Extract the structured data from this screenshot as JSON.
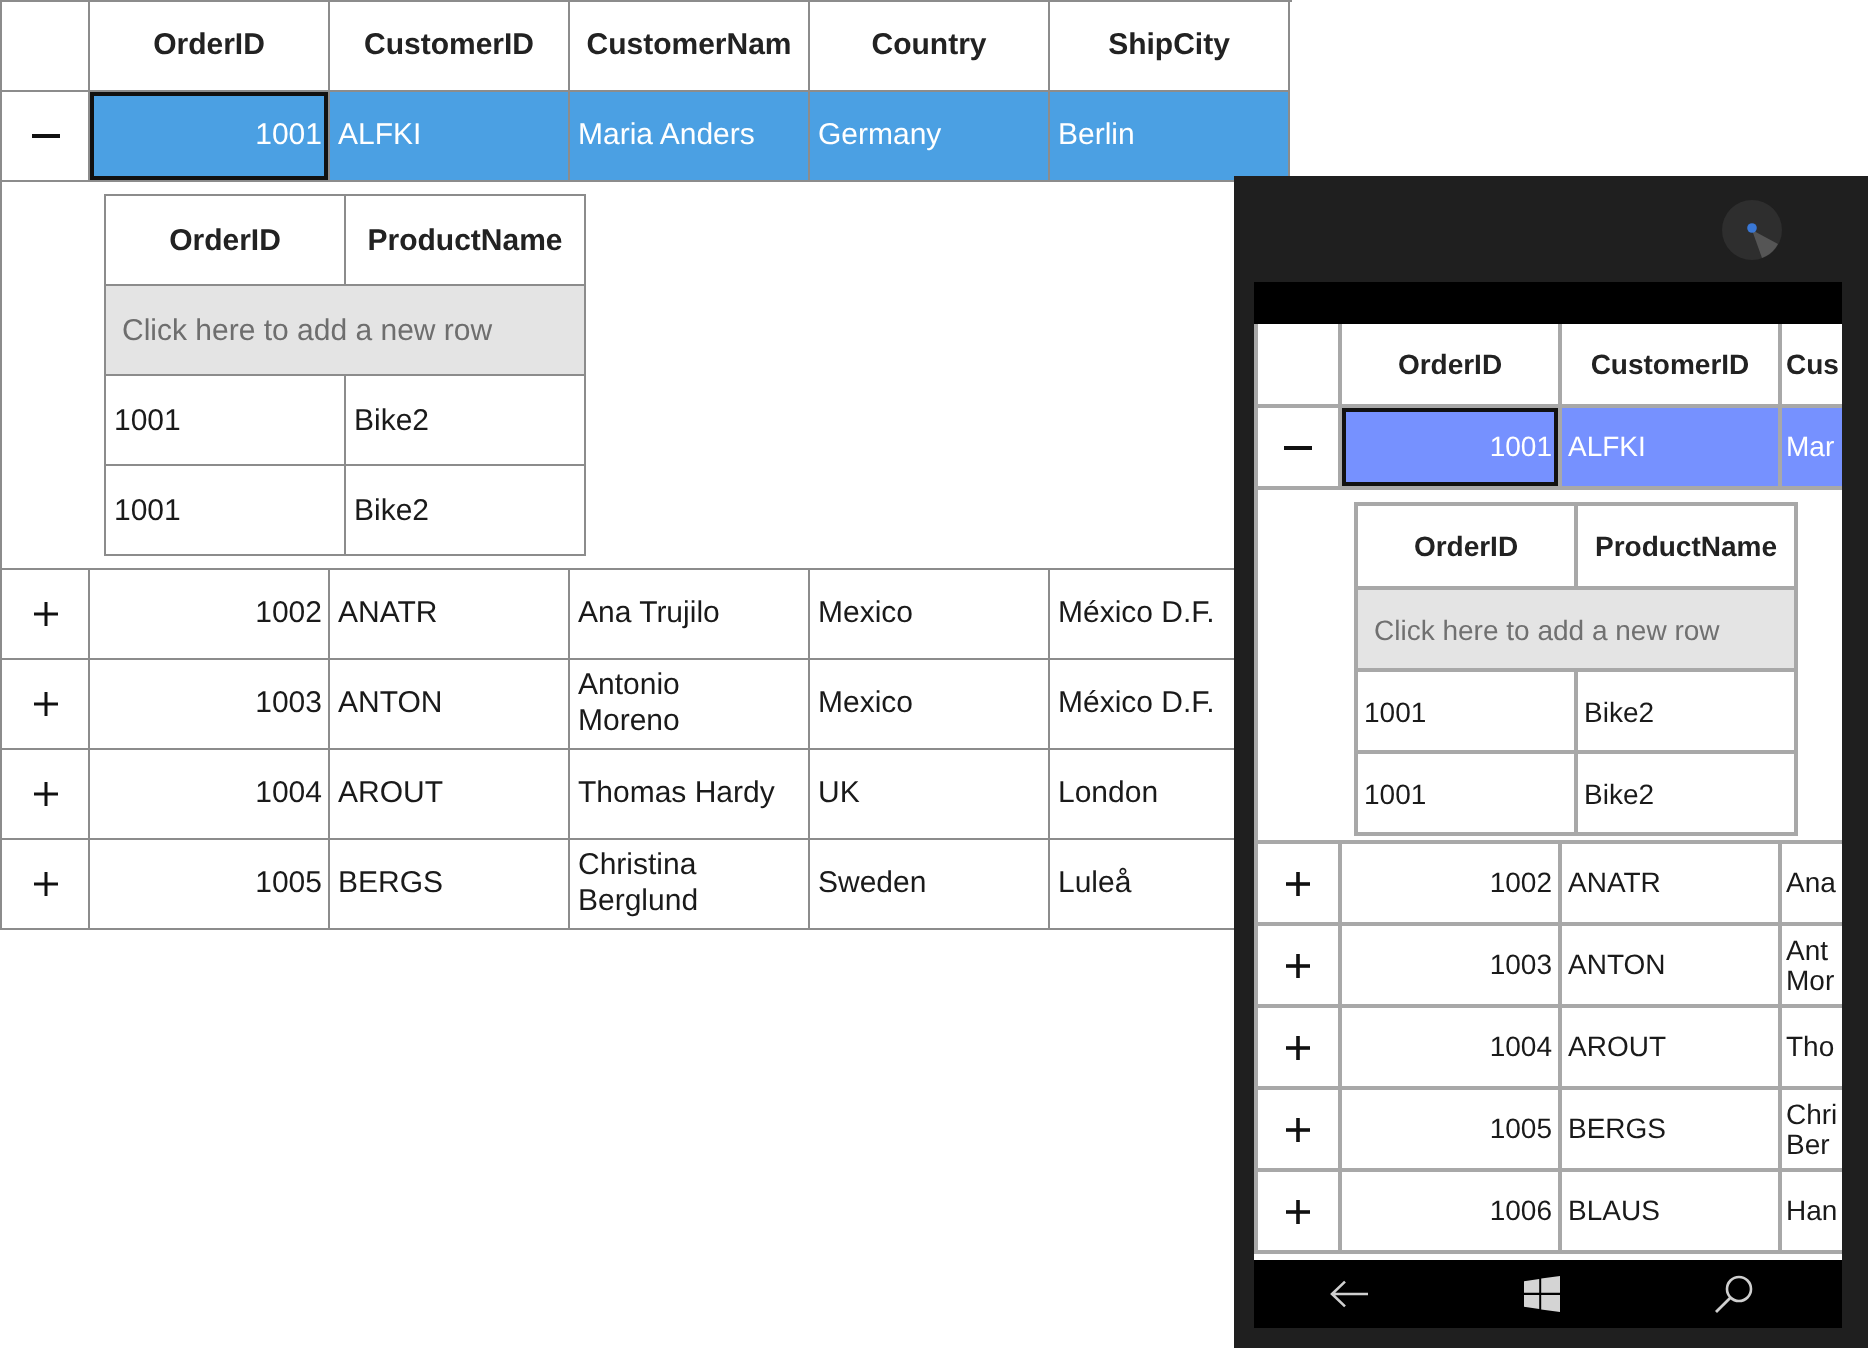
{
  "grid": {
    "columns": [
      {
        "label": "OrderID",
        "kind": "number"
      },
      {
        "label": "CustomerID",
        "kind": "text"
      },
      {
        "label": "CustomerNam",
        "kind": "text"
      },
      {
        "label": "Country",
        "kind": "text"
      },
      {
        "label": "ShipCity",
        "kind": "text"
      }
    ],
    "rows": [
      {
        "cells": [
          "1001",
          "ALFKI",
          "Maria Anders",
          "Germany",
          "Berlin"
        ],
        "selected": true,
        "expanded": true,
        "details": {
          "columns": [
            "OrderID",
            "ProductName"
          ],
          "add_row_prompt": "Click here to add a new row",
          "rows": [
            [
              "1001",
              "Bike2"
            ],
            [
              "1001",
              "Bike2"
            ]
          ]
        }
      },
      {
        "cells": [
          "1002",
          "ANATR",
          "Ana Trujilo",
          "Mexico",
          "México D.F."
        ],
        "selected": false,
        "expanded": false
      },
      {
        "cells": [
          "1003",
          "ANTON",
          "Antonio Moreno",
          "Mexico",
          "México D.F."
        ],
        "selected": false,
        "expanded": false
      },
      {
        "cells": [
          "1004",
          "AROUT",
          "Thomas Hardy",
          "UK",
          "London"
        ],
        "selected": false,
        "expanded": false
      },
      {
        "cells": [
          "1005",
          "BERGS",
          "Christina Berglund",
          "Sweden",
          "Luleå"
        ],
        "selected": false,
        "expanded": false
      }
    ]
  },
  "phone": {
    "grid": {
      "columns": [
        {
          "label": "OrderID",
          "kind": "number"
        },
        {
          "label": "CustomerID",
          "kind": "text"
        },
        {
          "label": "Cus",
          "kind": "text"
        }
      ],
      "rows": [
        {
          "cells": [
            "1001",
            "ALFKI",
            "Mar"
          ],
          "selected": true,
          "expanded": true,
          "details": {
            "columns": [
              "OrderID",
              "ProductName"
            ],
            "add_row_prompt": "Click here to add a new row",
            "rows": [
              [
                "1001",
                "Bike2"
              ],
              [
                "1001",
                "Bike2"
              ]
            ]
          }
        },
        {
          "cells": [
            "1002",
            "ANATR",
            "Ana"
          ],
          "selected": false,
          "expanded": false
        },
        {
          "cells": [
            "1003",
            "ANTON",
            "Ant Mor"
          ],
          "selected": false,
          "expanded": false
        },
        {
          "cells": [
            "1004",
            "AROUT",
            "Tho"
          ],
          "selected": false,
          "expanded": false
        },
        {
          "cells": [
            "1005",
            "BERGS",
            "Chri Ber"
          ],
          "selected": false,
          "expanded": false
        },
        {
          "cells": [
            "1006",
            "BLAUS",
            "Han"
          ],
          "selected": false,
          "expanded": false
        }
      ]
    }
  }
}
